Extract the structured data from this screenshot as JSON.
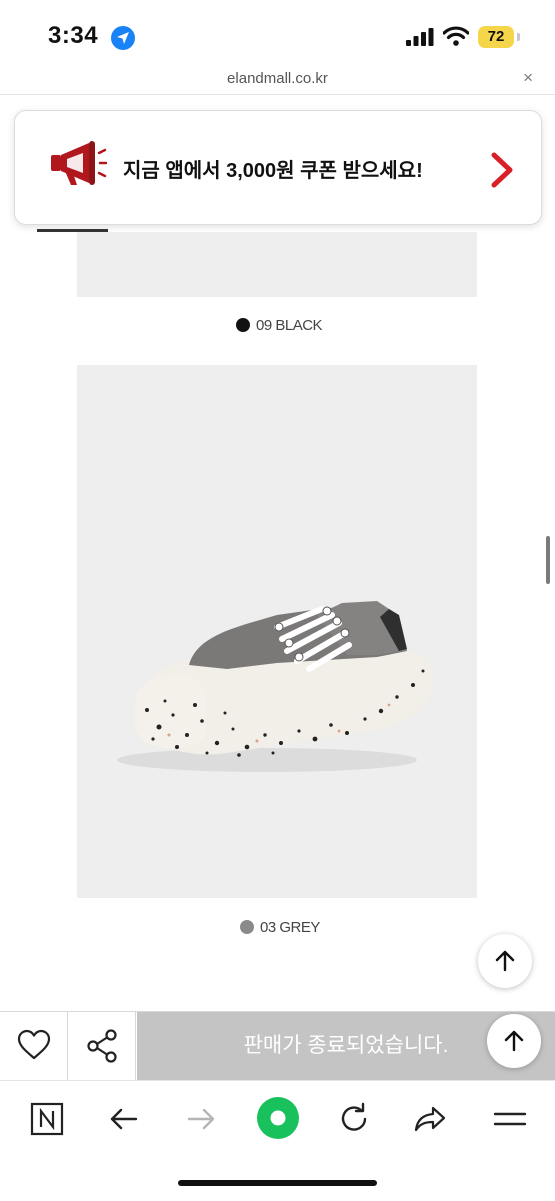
{
  "status_bar": {
    "time": "3:34",
    "battery": "72"
  },
  "browser": {
    "url": "elandmall.co.kr",
    "close_symbol": "×"
  },
  "promo": {
    "text": "지금 앱에서 3,000원 쿠폰 받으세요!"
  },
  "product": {
    "colors": [
      {
        "label": "09 BLACK",
        "swatch": "#111111"
      },
      {
        "label": "03 GREY",
        "swatch": "#8a8a8a"
      }
    ]
  },
  "action_bar": {
    "status": "판매가 종료되었습니다."
  },
  "icons": [
    "location-arrow-icon",
    "signal-icon",
    "wifi-icon",
    "megaphone-icon",
    "chevron-right-icon",
    "arrow-up-icon",
    "heart-icon",
    "share-icon",
    "naver-n-icon",
    "back-arrow-icon",
    "forward-arrow-icon",
    "green-dot-icon",
    "refresh-icon",
    "share-arrow-icon",
    "menu-icon"
  ],
  "colors": {
    "promo_arrow": "#d92027",
    "megaphone": "#b0181e",
    "green": "#19c15c",
    "soldout_bg": "#c4c4c4",
    "battery": "#f5d64b"
  }
}
